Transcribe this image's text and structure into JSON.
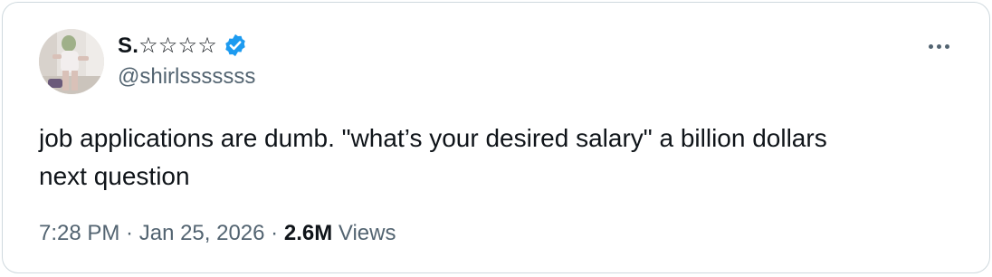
{
  "user": {
    "display_name": "S.☆☆☆☆",
    "handle": "@shirlsssssss",
    "verified_icon": "verified-badge-icon",
    "avatar": "profile-photo"
  },
  "menu": {
    "icon": "more-options-icon"
  },
  "tweet": {
    "text": "job applications are dumb. \"what’s your desired salary\" a billion dollars\nnext question"
  },
  "meta": {
    "time": "7:28 PM",
    "separator": " · ",
    "date": "Jan 25, 2026",
    "views_count": "2.6M",
    "views_label": "Views"
  },
  "colors": {
    "text_primary": "#0f1419",
    "text_secondary": "#536471",
    "verified_blue": "#1d9bf0",
    "border": "#cfd9de"
  }
}
